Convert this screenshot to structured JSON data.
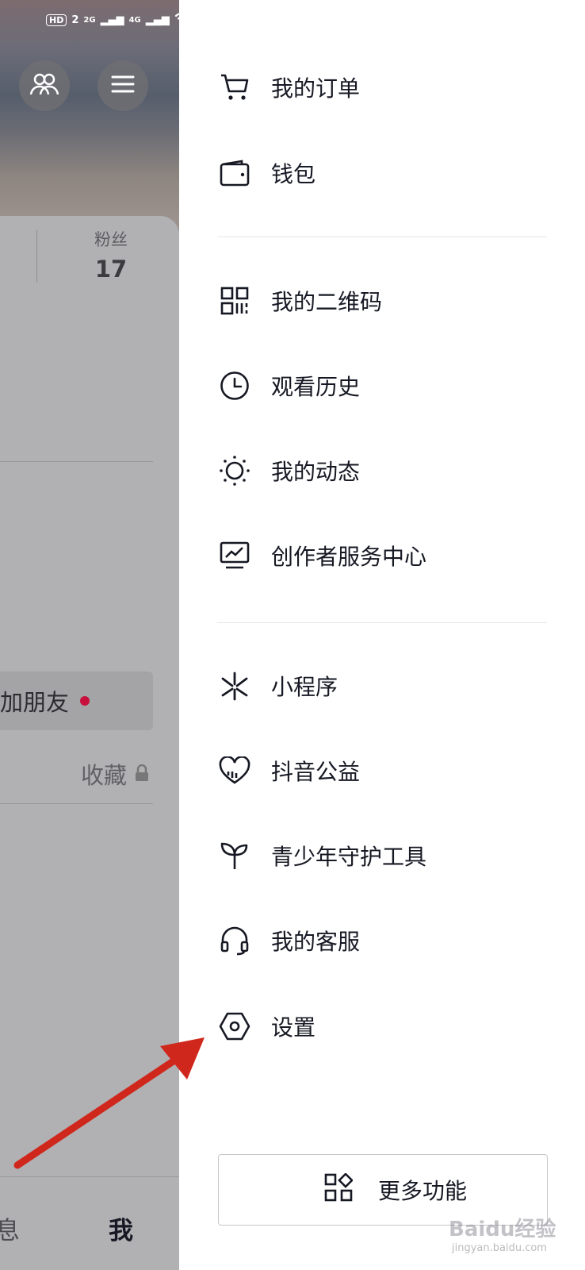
{
  "status_bar": {
    "hd": "HD",
    "sim": "2",
    "net1": "2G",
    "net2": "4G"
  },
  "profile": {
    "fans_label": "粉丝",
    "fans_count": "17",
    "add_friend": "加朋友",
    "collect": "收藏"
  },
  "bottom_tabs": {
    "messages": "息",
    "me": "我"
  },
  "drawer": {
    "items": [
      {
        "label": "我的订单",
        "icon": "cart-icon"
      },
      {
        "label": "钱包",
        "icon": "wallet-icon"
      },
      {
        "label": "我的二维码",
        "icon": "qr-code-icon"
      },
      {
        "label": "观看历史",
        "icon": "clock-icon"
      },
      {
        "label": "我的动态",
        "icon": "sun-icon"
      },
      {
        "label": "创作者服务中心",
        "icon": "monitor-chart-icon"
      },
      {
        "label": "小程序",
        "icon": "mini-program-icon"
      },
      {
        "label": "抖音公益",
        "icon": "heart-icon"
      },
      {
        "label": "青少年守护工具",
        "icon": "sprout-icon"
      },
      {
        "label": "我的客服",
        "icon": "headset-icon"
      },
      {
        "label": "设置",
        "icon": "settings-hexagon-icon"
      }
    ],
    "more_button": "更多功能"
  },
  "watermark": {
    "brand": "Baidu经验",
    "url": "jingyan.baidu.com"
  },
  "colors": {
    "accent_red": "#c8103c",
    "arrow": "#d0271d"
  }
}
